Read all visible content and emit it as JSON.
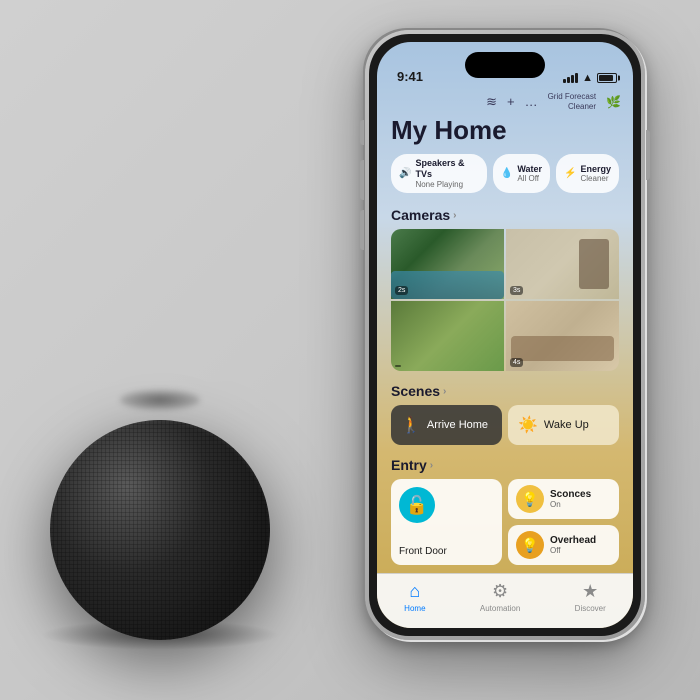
{
  "background": {
    "color": "#d0d0d0"
  },
  "phone": {
    "status_bar": {
      "time": "9:41",
      "signal_label": "signal",
      "wifi_label": "wifi",
      "battery_label": "battery"
    },
    "toolbar": {
      "grid_forecast_label": "Grid Forecast",
      "grid_forecast_value": "Cleaner",
      "add_icon": "+",
      "more_icon": "···",
      "audio_icon": "♪"
    },
    "page_title": "My Home",
    "chips": [
      {
        "icon": "🔊",
        "title": "Speakers & TVs",
        "sub": "None Playing"
      },
      {
        "icon": "💧",
        "title": "Water",
        "sub": "All Off"
      },
      {
        "icon": "⚡",
        "title": "Energy",
        "sub": "Cleaner"
      }
    ],
    "cameras_section": {
      "label": "Cameras",
      "arrow": "›",
      "cells": [
        {
          "timestamp": "2s"
        },
        {
          "timestamp": "3s"
        },
        {
          "timestamp": ""
        },
        {
          "timestamp": "4s"
        }
      ]
    },
    "scenes_section": {
      "label": "Scenes",
      "arrow": "›",
      "items": [
        {
          "icon": "🚶",
          "label": "Arrive Home",
          "style": "dark"
        },
        {
          "icon": "☀️",
          "label": "Wake Up",
          "style": "light"
        }
      ]
    },
    "entry_section": {
      "label": "Entry",
      "arrow": "›",
      "main_card": {
        "icon": "🔓",
        "label": "Front Door",
        "icon_bg": "#00b8d4"
      },
      "side_cards": [
        {
          "icon": "💡",
          "icon_bg": "#f0c040",
          "label": "Sconces",
          "sub": "On"
        },
        {
          "icon": "💡",
          "icon_bg": "#e8a020",
          "label": "Overhead",
          "sub": "Off"
        }
      ]
    },
    "tab_bar": {
      "items": [
        {
          "icon": "⌂",
          "label": "Home",
          "active": true
        },
        {
          "icon": "⚙",
          "label": "Automation",
          "active": false
        },
        {
          "icon": "★",
          "label": "Discover",
          "active": false
        }
      ]
    }
  },
  "homepod": {
    "label": "HomePod mini"
  }
}
